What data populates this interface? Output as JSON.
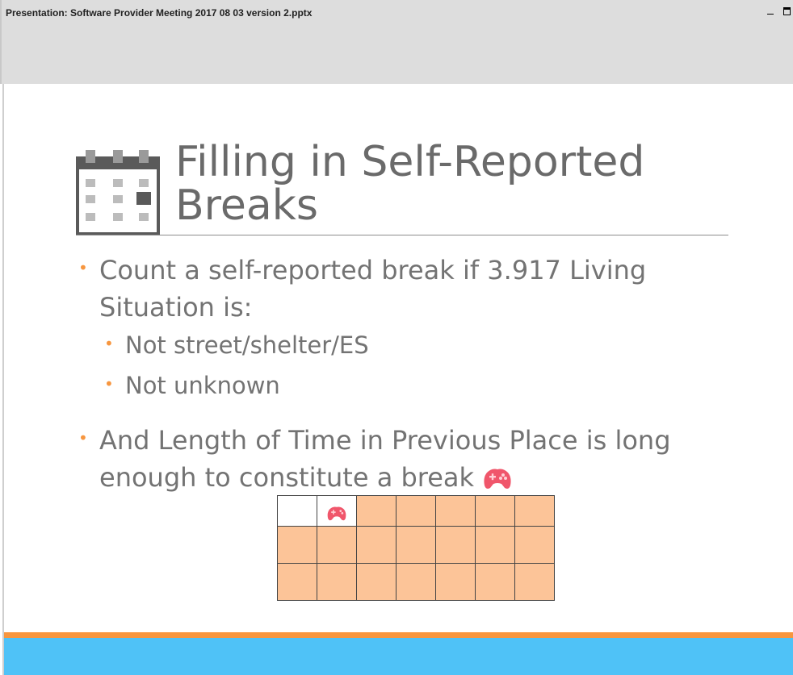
{
  "window": {
    "title": "Presentation: Software Provider Meeting 2017 08 03 version 2.pptx"
  },
  "slide": {
    "title_line1": "Filling in Self-Reported",
    "title_line2": "Breaks",
    "title_icon": "calendar-icon",
    "bullets": [
      {
        "level": 1,
        "text": "Count a self-reported break if 3.917 Living Situation is:"
      },
      {
        "level": 2,
        "text": "Not street/shelter/ES"
      },
      {
        "level": 2,
        "text": "Not unknown"
      },
      {
        "level": 1,
        "text": "And Length of Time in Previous Place is long enough to constitute a break"
      }
    ],
    "bullet_icon": "gamepad-icon",
    "grid": {
      "rows": 3,
      "cols": 7,
      "white_cell_row": 0,
      "white_cell_cols": [
        0,
        1
      ],
      "icon_cell": [
        0,
        1
      ]
    },
    "colors": {
      "accent_orange": "#f7963f",
      "footer_blue": "#4fc2f7",
      "cell_fill": "#fcc498",
      "title_gray": "#6a6a6a",
      "text_gray": "#737373",
      "gamepad_pink": "#f0566b"
    }
  }
}
